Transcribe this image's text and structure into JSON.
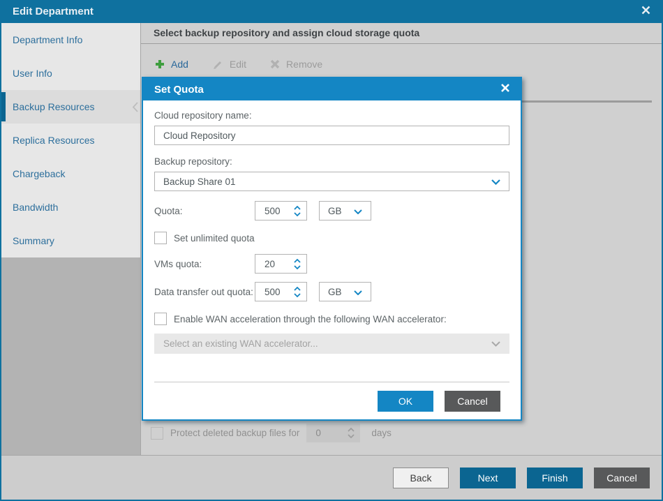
{
  "window": {
    "title": "Edit Department"
  },
  "sidebar": {
    "items": [
      {
        "label": "Department Info"
      },
      {
        "label": "User Info"
      },
      {
        "label": "Backup Resources"
      },
      {
        "label": "Replica Resources"
      },
      {
        "label": "Chargeback"
      },
      {
        "label": "Bandwidth"
      },
      {
        "label": "Summary"
      }
    ],
    "selected": "Backup Resources"
  },
  "content": {
    "header": "Select backup repository and assign cloud storage quota",
    "toolbar": {
      "add": "Add",
      "edit": "Edit",
      "remove": "Remove"
    },
    "protect": {
      "label": "Protect deleted backup files for",
      "value": "0",
      "suffix": "days",
      "checked": false
    }
  },
  "modal": {
    "title": "Set Quota",
    "repo_name": {
      "label": "Cloud repository name:",
      "value": "Cloud Repository"
    },
    "backup_repo": {
      "label": "Backup repository:",
      "value": "Backup Share 01"
    },
    "quota": {
      "label": "Quota:",
      "value": "500",
      "unit": "GB"
    },
    "unlimited": {
      "label": "Set unlimited quota",
      "checked": false
    },
    "vms": {
      "label": "VMs quota:",
      "value": "20"
    },
    "transfer": {
      "label": "Data transfer out quota:",
      "value": "500",
      "unit": "GB"
    },
    "wan": {
      "label": "Enable WAN acceleration through the following WAN accelerator:",
      "checked": false
    },
    "wan_select": {
      "placeholder": "Select an existing WAN accelerator..."
    },
    "buttons": {
      "ok": "OK",
      "cancel": "Cancel"
    }
  },
  "footer": {
    "back": "Back",
    "next": "Next",
    "finish": "Finish",
    "cancel": "Cancel"
  },
  "colors": {
    "titlebar": "#0f719f",
    "modal_accent": "#1486c4",
    "primary_button": "#0b6591",
    "dark_button": "#58595a",
    "add_green": "#3f9e3f"
  }
}
